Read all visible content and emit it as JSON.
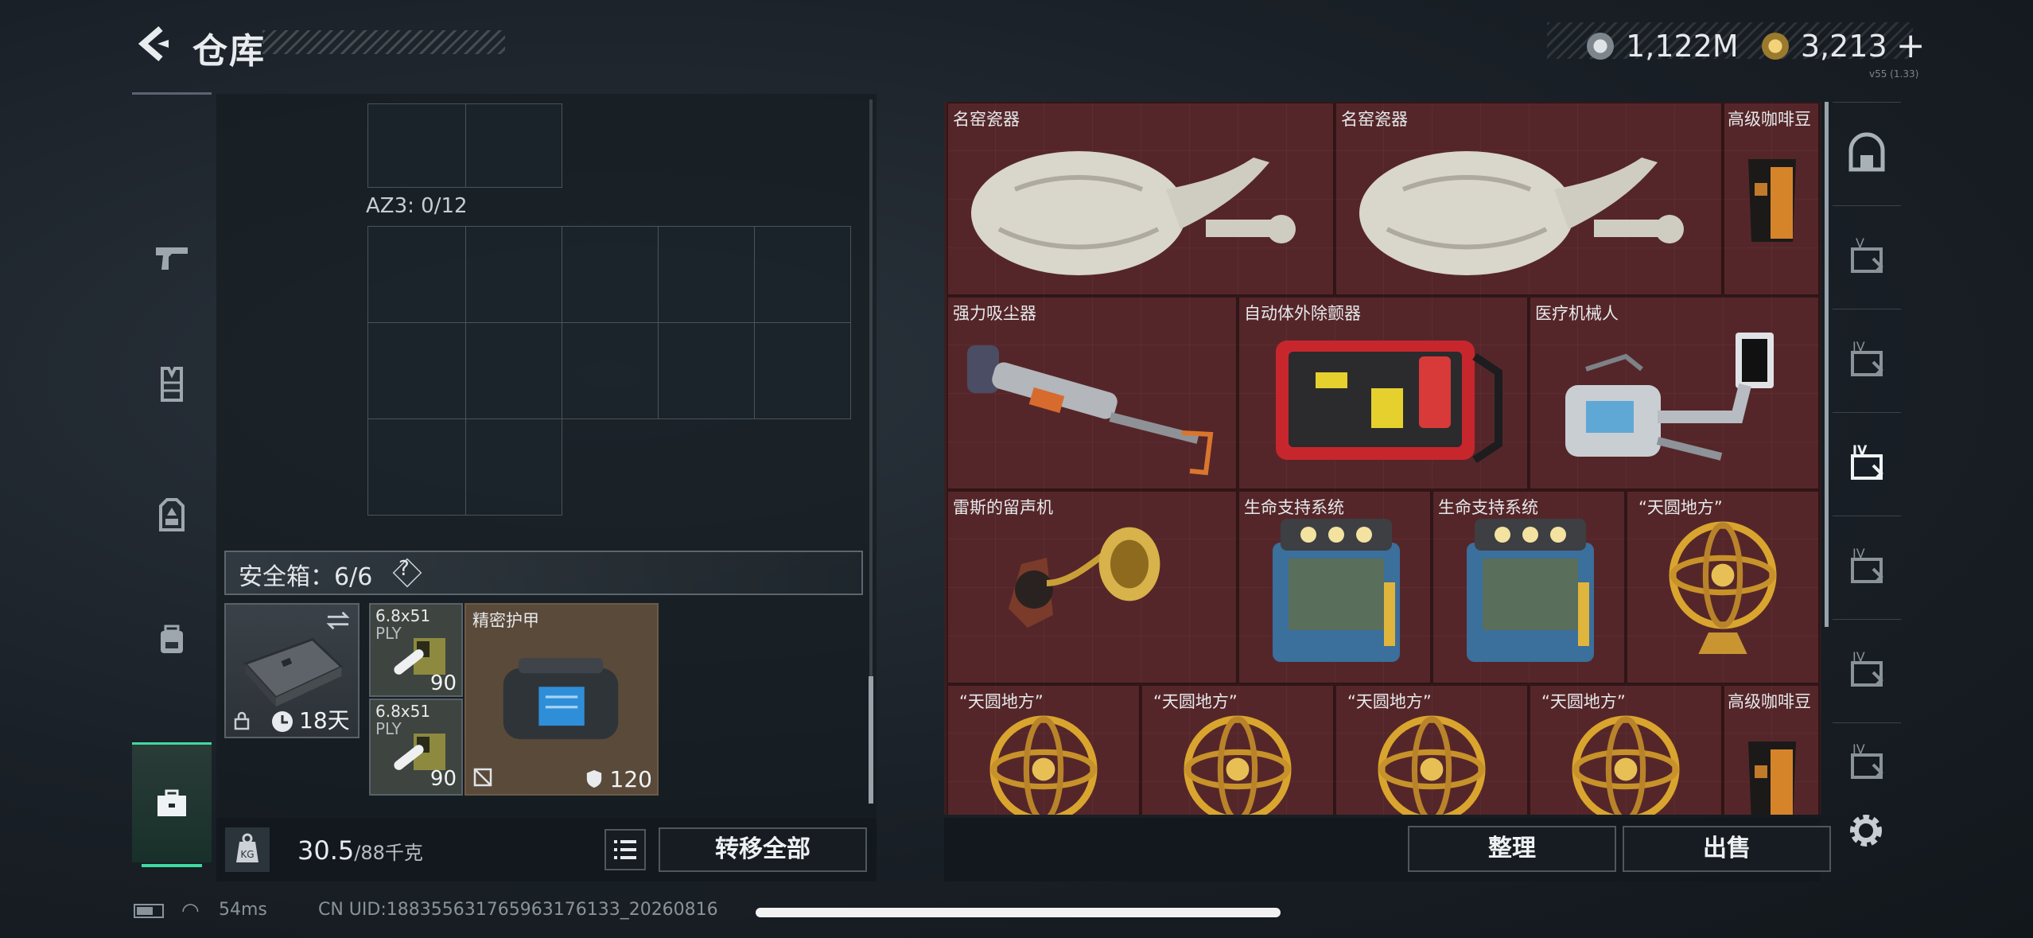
{
  "header": {
    "title": "仓库",
    "currency_silver": "1,122M",
    "currency_gold": "3,213",
    "currency_add": "+",
    "version": "v55 (1.33)"
  },
  "left_nav": {
    "items": [
      {
        "name": "weapon",
        "icon": "pistol-icon"
      },
      {
        "name": "armor-vest",
        "icon": "vest-icon"
      },
      {
        "name": "chest-rig",
        "icon": "chest-rig-icon"
      },
      {
        "name": "backpack",
        "icon": "backpack-icon"
      },
      {
        "name": "container",
        "icon": "case-icon"
      },
      {
        "name": "safe-box",
        "icon": "briefcase-icon",
        "active": true
      }
    ]
  },
  "inventory": {
    "az3_label": "AZ3: 0/12",
    "safe_box_label": "安全箱：6/6",
    "safe_box_help": "?",
    "safe_case": {
      "duration": "18天"
    },
    "ammo": [
      {
        "name": "6.8x51",
        "sub": "PLY",
        "count": "90"
      },
      {
        "name": "6.8x51",
        "sub": "PLY",
        "count": "90"
      }
    ],
    "armor_item": {
      "name": "精密护甲",
      "durability": "120"
    }
  },
  "bottom_left": {
    "weight_value": "30.5",
    "weight_capacity": "/88千克",
    "transfer_label": "转移全部"
  },
  "stash": {
    "items": [
      {
        "name": "名窑瓷器",
        "icon": "porcelain-vase-icon"
      },
      {
        "name": "名窑瓷器",
        "icon": "porcelain-vase-icon"
      },
      {
        "name": "高级咖啡豆",
        "icon": "coffee-bag-icon"
      },
      {
        "name": "强力吸尘器",
        "icon": "vacuum-icon"
      },
      {
        "name": "自动体外除颤器",
        "icon": "defibrillator-icon"
      },
      {
        "name": "医疗机械人",
        "icon": "medical-robot-icon"
      },
      {
        "name": "雷斯的留声机",
        "icon": "gramophone-icon"
      },
      {
        "name": "生命支持系统",
        "icon": "life-support-icon"
      },
      {
        "name": "生命支持系统",
        "icon": "life-support-icon"
      },
      {
        "name": "“天圆地方”",
        "icon": "armillary-sphere-icon"
      },
      {
        "name": "“天圆地方”",
        "icon": "armillary-sphere-icon"
      },
      {
        "name": "“天圆地方”",
        "icon": "armillary-sphere-icon"
      },
      {
        "name": "“天圆地方”",
        "icon": "armillary-sphere-icon"
      },
      {
        "name": "“天圆地方”",
        "icon": "armillary-sphere-icon"
      },
      {
        "name": "高级咖啡豆",
        "icon": "coffee-bag-icon"
      }
    ],
    "sort_label": "整理",
    "sell_label": "出售"
  },
  "right_nav": {
    "tabs": [
      {
        "label": "",
        "icon": "home-vault-icon"
      },
      {
        "label": "V",
        "icon": "stash-tab-v-icon"
      },
      {
        "label": "IV",
        "icon": "stash-tab-iv-icon"
      },
      {
        "label": "IV",
        "icon": "stash-tab-iv-icon",
        "active": true
      },
      {
        "label": "IV",
        "icon": "stash-tab-iv-icon"
      },
      {
        "label": "IV",
        "icon": "stash-tab-iv-icon"
      },
      {
        "label": "IV",
        "icon": "stash-tab-iv-icon"
      }
    ]
  },
  "status": {
    "ping": "54ms",
    "uid": "CN UID:1883556317659631761​33_20260816"
  },
  "colors": {
    "accent": "#3fd9a0",
    "stash_bg": "#4a2427",
    "armor_bg": "#5a4a3a"
  }
}
